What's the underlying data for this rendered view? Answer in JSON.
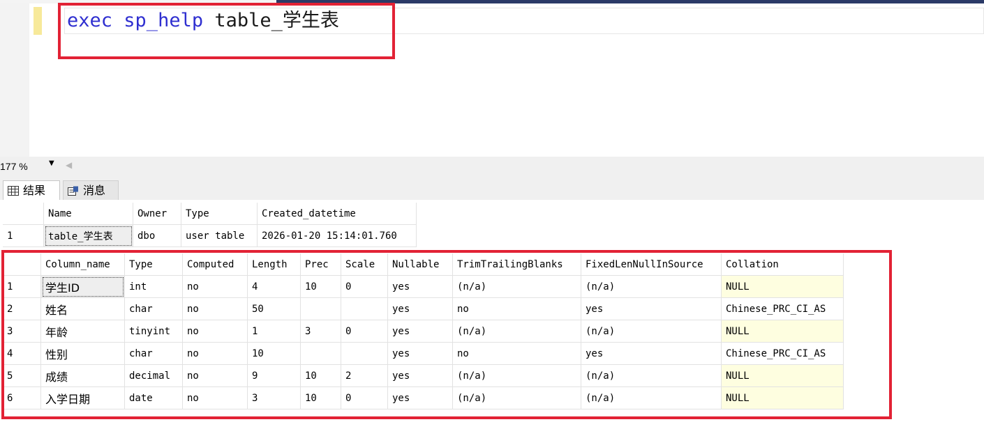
{
  "editor": {
    "keyword": "exec",
    "procedure": "sp_help",
    "argument": "table_学生表"
  },
  "zoom": {
    "value": "177 %"
  },
  "tabs": [
    {
      "label": "结果",
      "icon": "grid-icon"
    },
    {
      "label": "消息",
      "icon": "message-icon"
    }
  ],
  "table1": {
    "headers": [
      "Name",
      "Owner",
      "Type",
      "Created_datetime"
    ],
    "rows": [
      {
        "num": "1",
        "cells": [
          "table_学生表",
          "dbo",
          "user table",
          "2026-01-20 15:14:01.760"
        ]
      }
    ]
  },
  "table2": {
    "headers": [
      "Column_name",
      "Type",
      "Computed",
      "Length",
      "Prec",
      "Scale",
      "Nullable",
      "TrimTrailingBlanks",
      "FixedLenNullInSource",
      "Collation"
    ],
    "rows": [
      {
        "num": "1",
        "cells": [
          "学生ID",
          "int",
          "no",
          "4",
          "10",
          "0",
          "yes",
          "(n/a)",
          "(n/a)",
          "NULL"
        ]
      },
      {
        "num": "2",
        "cells": [
          "姓名",
          "char",
          "no",
          "50",
          "",
          "",
          "yes",
          "no",
          "yes",
          "Chinese_PRC_CI_AS"
        ]
      },
      {
        "num": "3",
        "cells": [
          "年龄",
          "tinyint",
          "no",
          "1",
          "3",
          "0",
          "yes",
          "(n/a)",
          "(n/a)",
          "NULL"
        ]
      },
      {
        "num": "4",
        "cells": [
          "性别",
          "char",
          "no",
          "10",
          "",
          "",
          "yes",
          "no",
          "yes",
          "Chinese_PRC_CI_AS"
        ]
      },
      {
        "num": "5",
        "cells": [
          "成绩",
          "decimal",
          "no",
          "9",
          "10",
          "2",
          "yes",
          "(n/a)",
          "(n/a)",
          "NULL"
        ]
      },
      {
        "num": "6",
        "cells": [
          "入学日期",
          "date",
          "no",
          "3",
          "10",
          "0",
          "yes",
          "(n/a)",
          "(n/a)",
          "NULL"
        ]
      }
    ]
  },
  "colors": {
    "highlight": "#e22235",
    "keyword": "#2f2fd0",
    "null_bg": "#fefee0"
  }
}
